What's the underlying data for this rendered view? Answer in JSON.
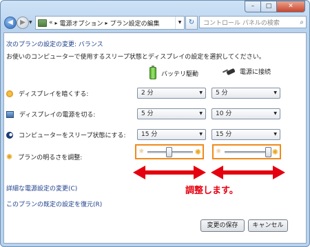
{
  "window": {
    "controls": {
      "minimize": "–",
      "maximize": "□",
      "close": "✕"
    }
  },
  "nav": {
    "back_icon": "◀",
    "forward_icon": "▶",
    "history_icon": "▼",
    "breadcrumb": {
      "overflow": "«",
      "sep": "▸",
      "item1": "電源オプション",
      "item2": "プラン設定の編集"
    },
    "dropdown_icon": "▼",
    "refresh_icon": "↻",
    "search_placeholder": "コントロール パネルの検索",
    "search_icon": "⌕"
  },
  "page": {
    "title": "次のプランの設定の変更: バランス",
    "description": "お使いのコンピューターで使用するスリープ状態とディスプレイの設定を選択してください。",
    "columns": {
      "battery": "バッテリ駆動",
      "plugged": "電源に接続"
    },
    "rows": [
      {
        "label": "ディスプレイを暗くする:",
        "battery": "2 分",
        "plugged": "5 分"
      },
      {
        "label": "ディスプレイの電源を切る:",
        "battery": "5 分",
        "plugged": "10 分"
      },
      {
        "label": "コンピューターをスリープ状態にする:",
        "battery": "15 分",
        "plugged": "15 分"
      }
    ],
    "brightness": {
      "label": "プランの明るさを調整:",
      "battery_level": 0.45,
      "plugged_level": 1.0,
      "dim_icon": "☼",
      "bright_icon": "✺"
    },
    "annotation": "調整します。",
    "links": {
      "advanced": "詳細な電源設定の変更(C)",
      "restore": "このプランの既定の設定を復元(R)"
    },
    "buttons": {
      "save": "変更の保存",
      "cancel": "キャンセル"
    },
    "select_arrow": "▼"
  },
  "colors": {
    "accent": "#1e3f8c",
    "highlight_border": "#f08a1a",
    "arrow_red": "#e4000f"
  }
}
